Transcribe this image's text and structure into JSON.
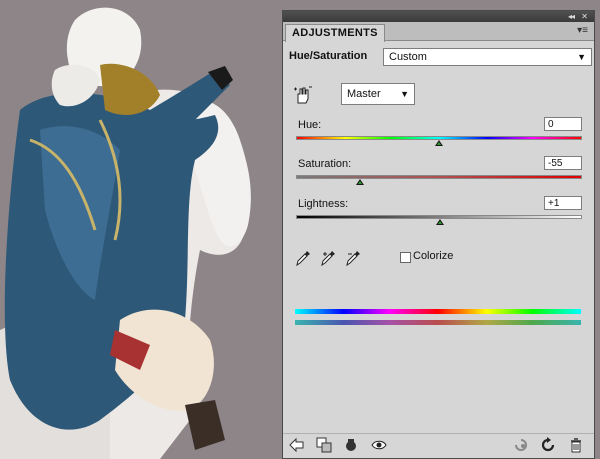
{
  "panel": {
    "tab_label": "ADJUSTMENTS",
    "collapse_glyph": "◂◂",
    "close_glyph": "✕",
    "menu_glyph": "▾≡"
  },
  "preset": {
    "label": "Hue/Saturation",
    "value": "Custom"
  },
  "channel": {
    "value": "Master"
  },
  "hue": {
    "label": "Hue:",
    "value": "0",
    "position": 0.5
  },
  "saturation": {
    "label": "Saturation:",
    "value": "-55",
    "position": 0.225
  },
  "lightness": {
    "label": "Lightness:",
    "value": "+1",
    "position": 0.505
  },
  "colorize": {
    "label": "Colorize",
    "checked": false
  },
  "icons": {
    "hand": "targeted-adjustment-hand-icon",
    "eyedroppers": [
      "eyedropper-icon",
      "eyedropper-plus-icon",
      "eyedropper-minus-icon"
    ],
    "footer": [
      "back-arrow-icon",
      "clip-to-layer-icon",
      "view-previous-icon",
      "visibility-eye-icon",
      "reset-icon",
      "refresh-icon",
      "trash-icon"
    ]
  },
  "colors": {
    "panel_bg": "#d6d6d6",
    "canvas_bg": "#8d8588",
    "thumb_green": "#2e9a2e"
  }
}
